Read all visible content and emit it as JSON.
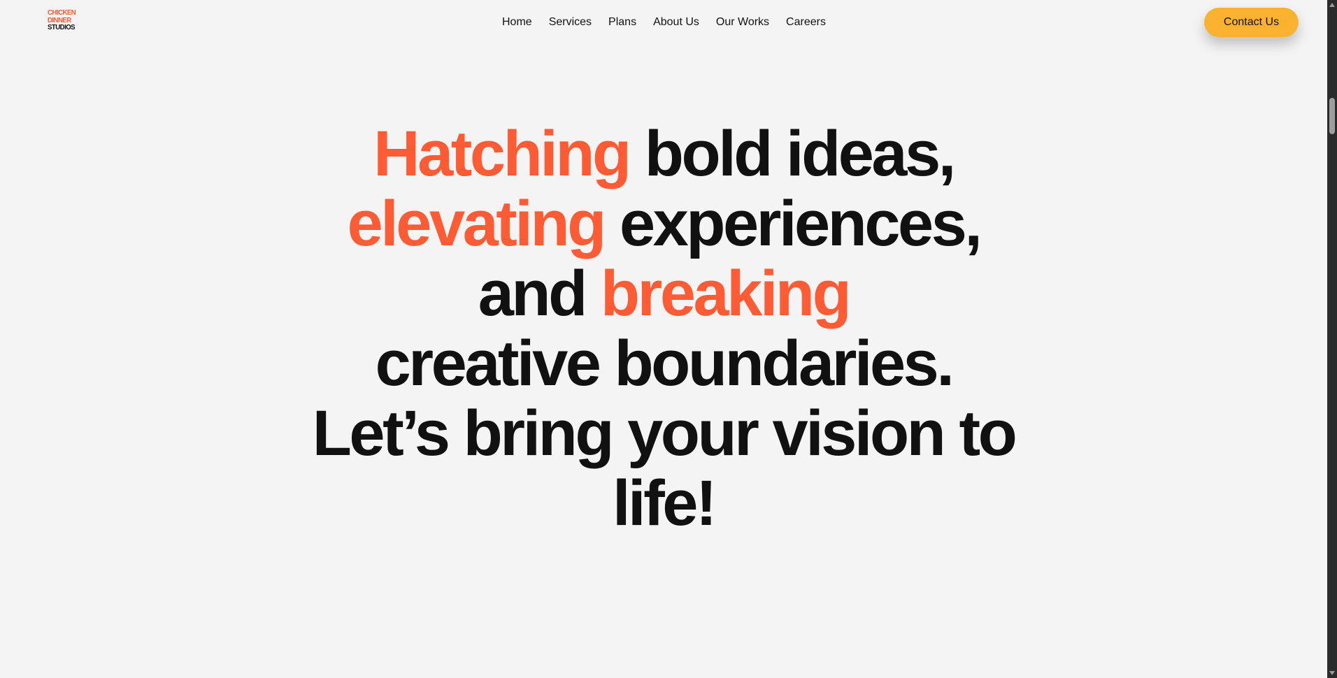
{
  "logo": {
    "line1": "CHICKEN",
    "line2": "DINNER",
    "line3": "STUDIOS"
  },
  "nav": {
    "items": [
      {
        "label": "Home"
      },
      {
        "label": "Services"
      },
      {
        "label": "Plans"
      },
      {
        "label": "About Us"
      },
      {
        "label": "Our Works"
      },
      {
        "label": "Careers"
      }
    ]
  },
  "header": {
    "contact_label": "Contact Us"
  },
  "hero": {
    "line1_accent": "Hatching",
    "line1_rest": " bold ideas,",
    "line2_accent": "elevating",
    "line2_rest": " experiences,",
    "line3_start": "and ",
    "line3_accent": "breaking",
    "line4": "creative boundaries.",
    "line5": "Let’s bring your vision to",
    "line6": "life!"
  },
  "colors": {
    "accent": "#ff5c35",
    "button": "#fbb231",
    "background": "#f4f4f4",
    "text": "#111111"
  }
}
